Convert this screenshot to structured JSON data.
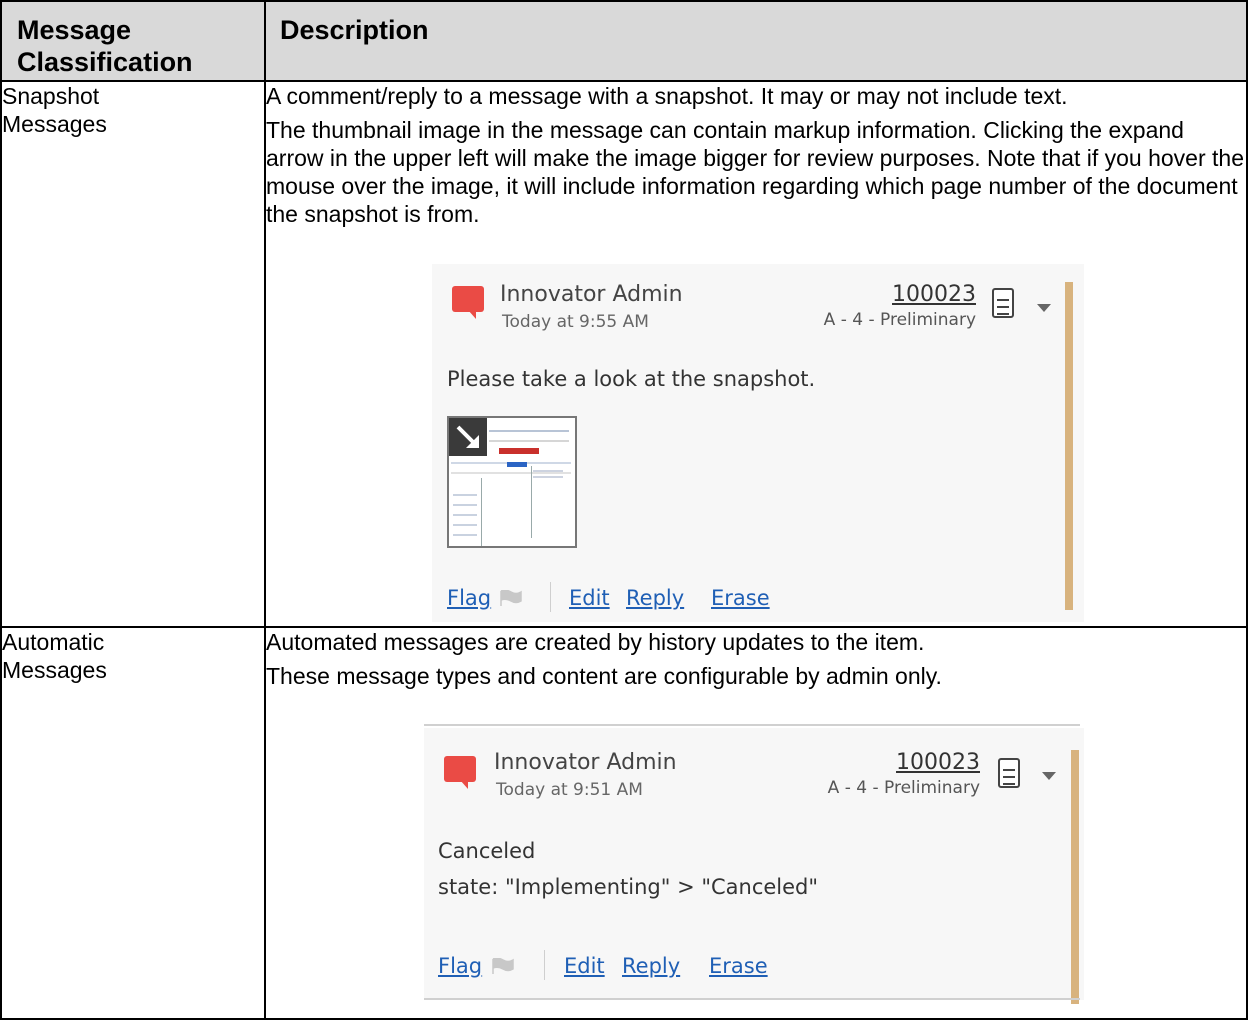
{
  "table": {
    "header": {
      "classification": "Message Classification",
      "description": "Description"
    },
    "rows": [
      {
        "classification": "Snapshot Messages",
        "paragraphs": [
          "A comment/reply to a message with a snapshot. It may or may not include text.",
          "The thumbnail image in the message can contain markup information.  Clicking the expand arrow in the upper left will make the image bigger for review purposes.  Note that if you hover the mouse over the image, it will include information regarding which page number of the document the snapshot is from."
        ],
        "message": {
          "author": "Innovator Admin",
          "time": "Today at 9:55 AM",
          "item_number": "100023",
          "item_state": "A - 4 - Preliminary",
          "text": "Please take a look at the snapshot.",
          "actions": {
            "flag": "Flag",
            "edit": "Edit",
            "reply": "Reply",
            "erase": "Erase"
          }
        }
      },
      {
        "classification": "Automatic Messages",
        "paragraphs": [
          "Automated messages are created by history updates to the item.",
          "These message types and content are configurable by admin only."
        ],
        "message": {
          "author": "Innovator Admin",
          "time": "Today at 9:51 AM",
          "item_number": "100023",
          "item_state": "A - 4 - Preliminary",
          "text_line1": "Canceled",
          "text_line2": "state: \"Implementing\" > \"Canceled\"",
          "actions": {
            "flag": "Flag",
            "edit": "Edit",
            "reply": "Reply",
            "erase": "Erase"
          }
        }
      }
    ]
  },
  "colors": {
    "header_bg": "#d9d9d9",
    "bubble": "#ea4b45",
    "accent_bar": "#d8b37e",
    "link": "#1f5fb5"
  },
  "icons": [
    "speech-bubble-icon",
    "document-icon",
    "caret-down-icon",
    "flag-icon",
    "expand-arrow-icon"
  ]
}
